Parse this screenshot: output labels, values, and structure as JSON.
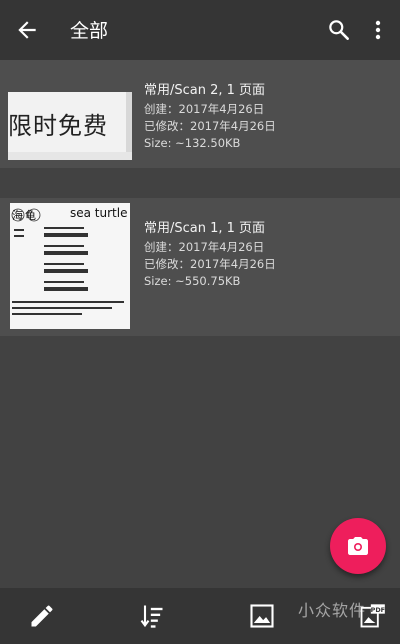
{
  "appbar": {
    "title": "全部",
    "back_icon": "arrow-back-icon",
    "search_icon": "search-icon",
    "more_icon": "more-vert-icon"
  },
  "documents": [
    {
      "name": "常用/Scan 2, 1 页面",
      "created": "创建：2017年4月26日",
      "modified": "已修改：2017年4月26日",
      "size": "Size: ~132.50KB",
      "thumb_text": "限时免费"
    },
    {
      "name": "常用/Scan 1, 1 页面",
      "created": "创建：2017年4月26日",
      "modified": "已修改：2017年4月26日",
      "size": "Size: ~550.75KB",
      "thumb_title_cn": "海龟",
      "thumb_title_en": "sea turtle"
    }
  ],
  "fab": {
    "icon": "camera-icon",
    "color": "#ee1e5c"
  },
  "bottom_bar": {
    "items": [
      "edit-icon",
      "sort-icon",
      "image-icon",
      "pdf-icon"
    ],
    "watermark": "小众软件"
  },
  "colors": {
    "background": "#424242",
    "appbar": "#353535",
    "row": "#4e4e4e",
    "accent": "#ee1e5c"
  }
}
